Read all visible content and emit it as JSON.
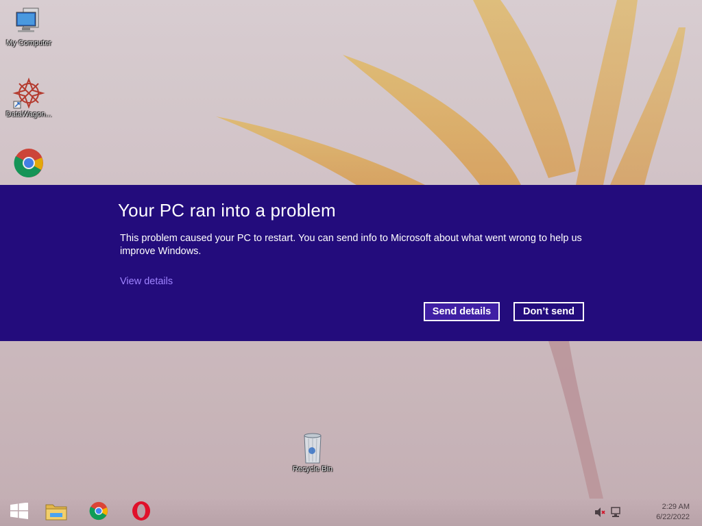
{
  "desktop": {
    "icons": [
      {
        "label": "My Computer",
        "icon": "computer-icon"
      },
      {
        "label": "DataWagon...",
        "icon": "datawagon-icon"
      },
      {
        "label": "",
        "icon": "chrome-icon"
      },
      {
        "label": "Recycle Bin",
        "icon": "recycle-bin-icon"
      }
    ]
  },
  "error": {
    "title": "Your PC ran into a problem",
    "message": "This problem caused your PC to restart. You can send info to Microsoft about what went wrong to help us improve Windows.",
    "view_details": "View details",
    "send_label": "Send details",
    "dont_send_label": "Don’t send",
    "colors": {
      "band": "#230c7c",
      "primary_button": "#3f1fa4",
      "link": "#9f84ff"
    }
  },
  "taskbar": {
    "items": [
      {
        "icon": "windows-start-icon"
      },
      {
        "icon": "file-explorer-icon"
      },
      {
        "icon": "chrome-icon"
      },
      {
        "icon": "opera-icon"
      }
    ],
    "tray": {
      "volume_icon": "volume-muted-icon",
      "network_icon": "network-icon"
    },
    "time": "2:29 AM",
    "date": "6/22/2022"
  }
}
